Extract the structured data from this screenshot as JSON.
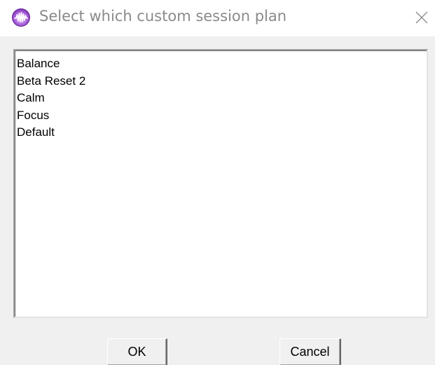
{
  "window": {
    "title": "Select which custom session plan",
    "app_icon": "app-logo-icon",
    "close_icon": "close-icon"
  },
  "session_list": {
    "items": [
      {
        "label": "Balance"
      },
      {
        "label": "Beta Reset 2"
      },
      {
        "label": "Calm"
      },
      {
        "label": "Focus"
      },
      {
        "label": "Default"
      }
    ]
  },
  "buttons": {
    "ok_label": "OK",
    "cancel_label": "Cancel"
  },
  "colors": {
    "titlebar_bg": "#ffffff",
    "dialog_bg": "#f0f0f0",
    "title_text": "#8a8a8a",
    "icon_accent": "#9b4dca"
  }
}
